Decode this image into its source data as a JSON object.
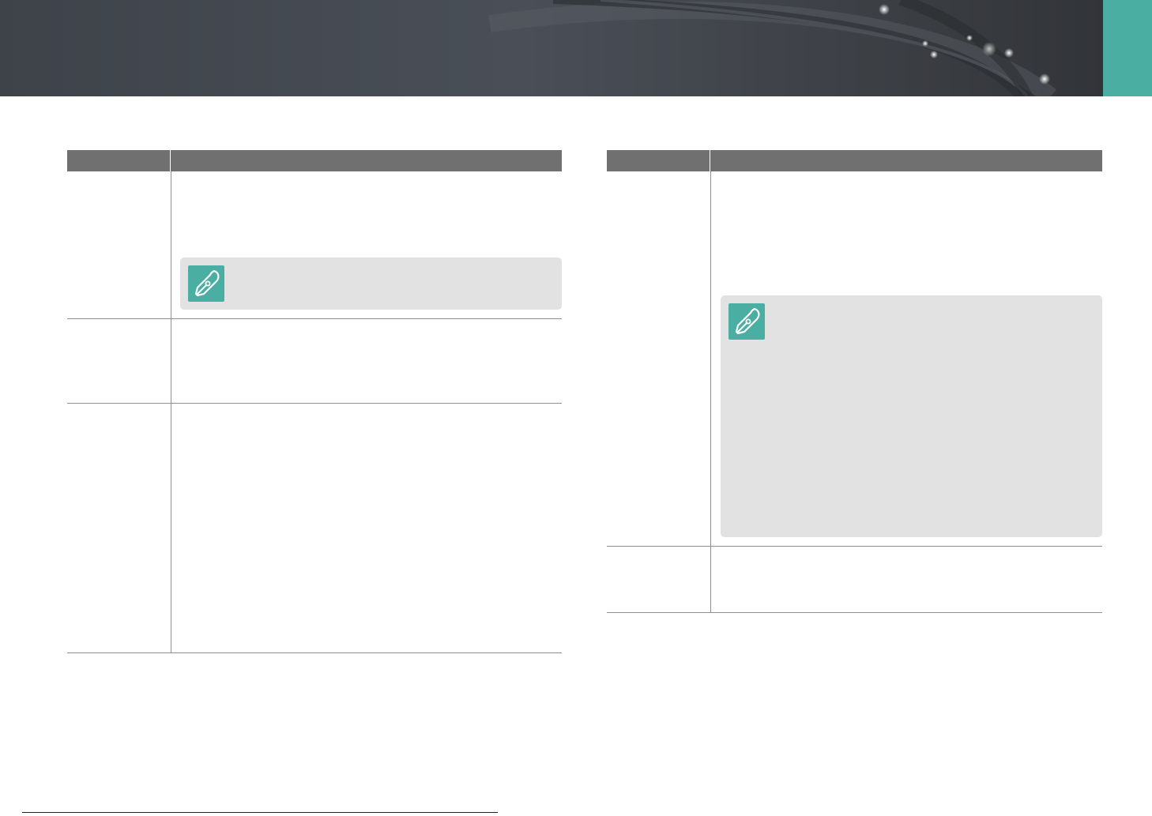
{
  "header": {
    "background_color": "#3c4046",
    "accent_color": "#4aaea3"
  },
  "left_table": {
    "header_color": "#707070",
    "rows": [
      {
        "label": "",
        "description": "",
        "has_note": true,
        "note_text": ""
      },
      {
        "label": "",
        "description": "",
        "has_note": false
      },
      {
        "label": "",
        "description": "",
        "has_note": false
      }
    ]
  },
  "right_table": {
    "header_color": "#707070",
    "rows": [
      {
        "label": "",
        "description": "",
        "has_note": true,
        "note_text": ""
      },
      {
        "label": "",
        "description": "",
        "has_note": false
      }
    ]
  },
  "icons": {
    "note": "pen-nib-icon"
  }
}
